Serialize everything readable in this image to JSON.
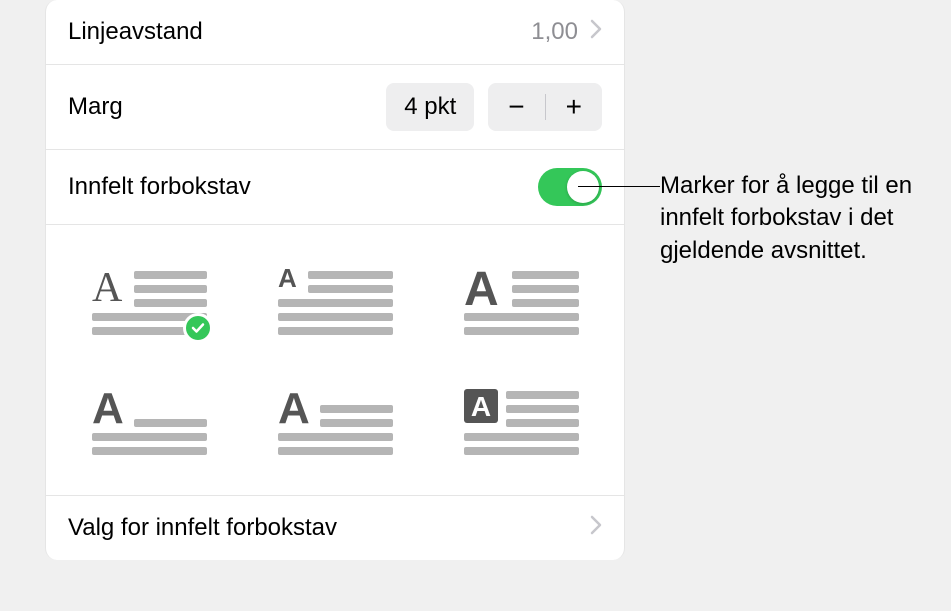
{
  "rows": {
    "linespacing": {
      "label": "Linjeavstand",
      "value": "1,00"
    },
    "margin": {
      "label": "Marg",
      "value": "4 pkt",
      "minus": "−",
      "plus": "+"
    },
    "dropcap": {
      "label": "Innfelt forbokstav"
    },
    "options": {
      "label": "Valg for innfelt forbokstav"
    }
  },
  "annotation": "Marker for å legge til en innfelt forbokstav i det gjeldende avsnittet."
}
